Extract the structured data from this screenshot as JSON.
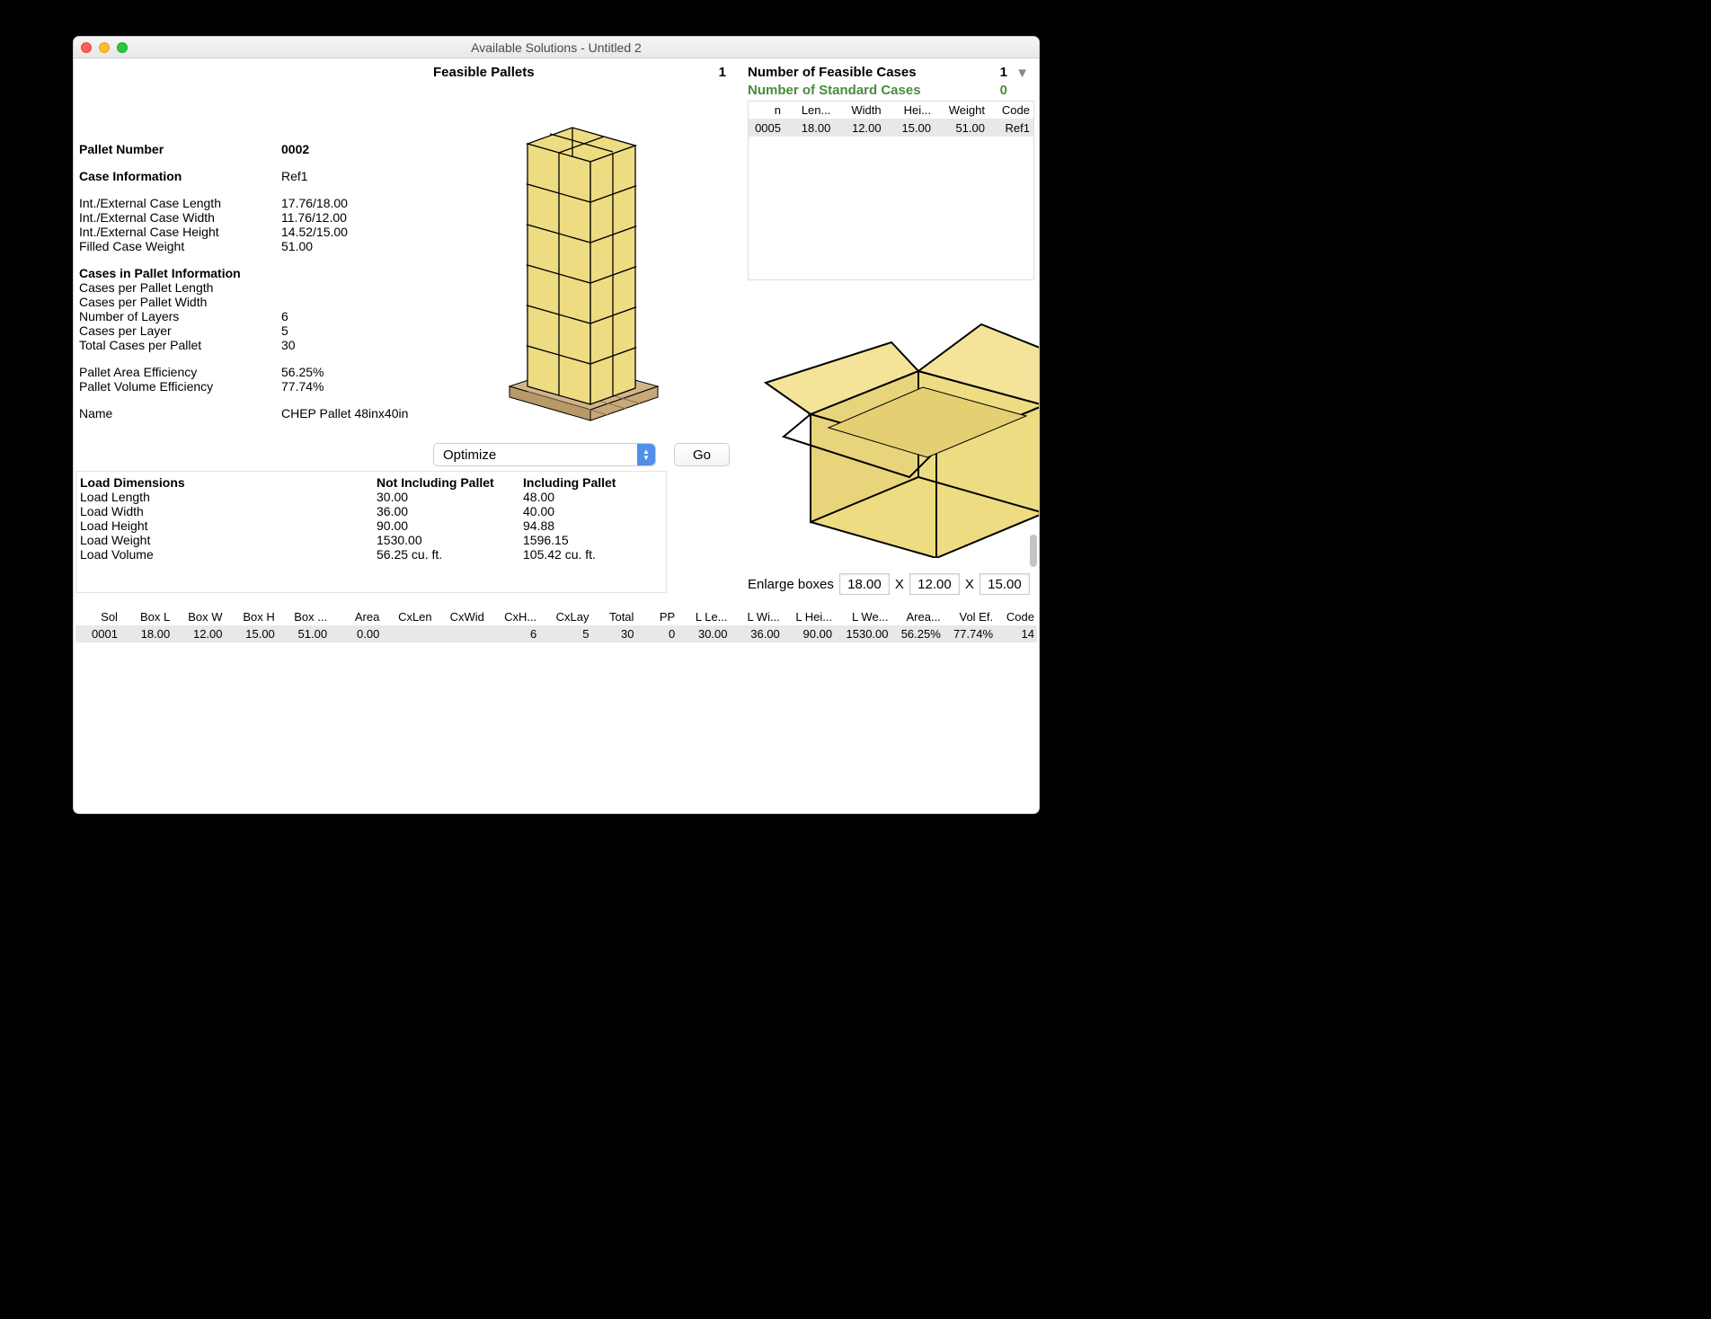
{
  "window": {
    "title": "Available Solutions - Untitled 2"
  },
  "left": {
    "pallet_number_label": "Pallet Number",
    "pallet_number": "0002",
    "case_info_label": "Case Information",
    "case_info": "Ref1",
    "dim_len_label": "Int./External Case Length",
    "dim_len": "17.76/18.00",
    "dim_wid_label": "Int./External Case Width",
    "dim_wid": "11.76/12.00",
    "dim_hei_label": "Int./External Case Height",
    "dim_hei": "14.52/15.00",
    "filled_wt_label": "Filled Case Weight",
    "filled_wt": "51.00",
    "cpi_label": "Cases in Pallet Information",
    "cpl_label": "Cases per Pallet Length",
    "cpl": "",
    "cpw_label": "Cases per Pallet Width",
    "cpw": "",
    "layers_label": "Number of Layers",
    "layers": "6",
    "cplay_label": "Cases per Layer",
    "cplay": "5",
    "total_label": "Total Cases per Pallet",
    "total": "30",
    "area_eff_label": "Pallet Area Efficiency",
    "area_eff": "56.25%",
    "vol_eff_label": "Pallet Volume Efficiency",
    "vol_eff": "77.74%",
    "name_label": "Name",
    "name": "CHEP Pallet 48inx40in"
  },
  "load": {
    "hdr_dim": "Load Dimensions",
    "hdr_notinc": "Not Including Pallet",
    "hdr_inc": "Including Pallet",
    "rows": [
      {
        "label": "Load Length",
        "ni": "30.00",
        "i": "48.00"
      },
      {
        "label": "Load Width",
        "ni": "36.00",
        "i": "40.00"
      },
      {
        "label": "Load Height",
        "ni": "90.00",
        "i": "94.88"
      },
      {
        "label": "Load Weight",
        "ni": "1530.00",
        "i": "1596.15"
      },
      {
        "label": "Load Volume",
        "ni": "56.25 cu. ft.",
        "i": "105.42 cu. ft."
      }
    ]
  },
  "mid": {
    "feasible_label": "Feasible Pallets",
    "feasible_count": "1",
    "optimize_label": "Optimize",
    "go_label": "Go"
  },
  "right": {
    "feasible_cases_label": "Number of Feasible Cases",
    "feasible_cases": "1",
    "standard_cases_label": "Number of Standard Cases",
    "standard_cases": "0",
    "case_headers": [
      "n",
      "Len...",
      "Width",
      "Hei...",
      "Weight",
      "Code"
    ],
    "case_row": [
      "0005",
      "18.00",
      "12.00",
      "15.00",
      "51.00",
      "Ref1"
    ],
    "enlarge_label": "Enlarge boxes",
    "enlarge_x": "X",
    "enlarge_vals": [
      "18.00",
      "12.00",
      "15.00"
    ]
  },
  "bottom": {
    "headers": [
      "Sol",
      "Box L",
      "Box W",
      "Box H",
      "Box ...",
      "Area",
      "CxLen",
      "CxWid",
      "CxH...",
      "CxLay",
      "Total",
      "PP",
      "L Le...",
      "L Wi...",
      "L Hei...",
      "L We...",
      "Area...",
      "Vol Ef.",
      "Code"
    ],
    "row": [
      "0001",
      "18.00",
      "12.00",
      "15.00",
      "51.00",
      "0.00",
      "",
      "",
      "6",
      "5",
      "30",
      "0",
      "30.00",
      "36.00",
      "90.00",
      "1530.00",
      "56.25%",
      "77.74%",
      "14"
    ]
  }
}
